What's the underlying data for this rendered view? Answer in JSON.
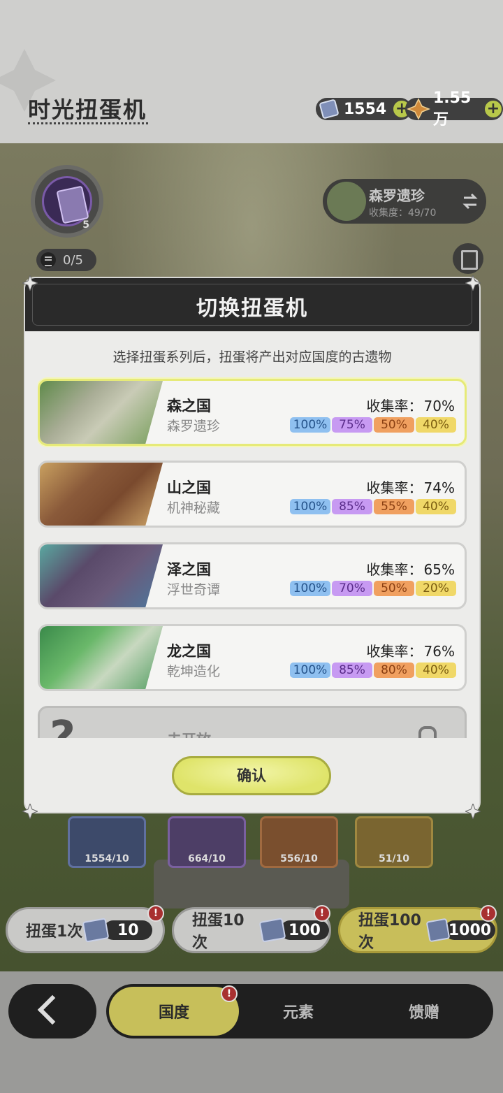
{
  "header": {
    "title": "时光扭蛋机",
    "currencies": [
      {
        "icon": "ticket-icon",
        "amount": "1554"
      },
      {
        "icon": "star-gem-icon",
        "amount": "1.55万"
      }
    ]
  },
  "background": {
    "medal_count": "5",
    "progress": "0/5",
    "series_chip": {
      "name": "森罗遗珍",
      "collection": "收集度：49/70"
    },
    "prize_slots": [
      "1554/10",
      "664/10",
      "556/10",
      "51/10"
    ],
    "draw_buttons": [
      {
        "label": "扭蛋1次",
        "cost": "10"
      },
      {
        "label": "扭蛋10次",
        "cost": "100"
      },
      {
        "label": "扭蛋100次",
        "cost": "1000"
      }
    ],
    "alert_mark": "!"
  },
  "modal": {
    "title": "切换扭蛋机",
    "subtitle": "选择扭蛋系列后，扭蛋将产出对应国度的古遗物",
    "rate_label": "收集率：",
    "items": [
      {
        "country": "森之国",
        "series": "森罗遗珍",
        "rate": "70%",
        "tiers": [
          "100%",
          "75%",
          "50%",
          "40%"
        ],
        "selected": true
      },
      {
        "country": "山之国",
        "series": "机神秘藏",
        "rate": "74%",
        "tiers": [
          "100%",
          "85%",
          "55%",
          "40%"
        ]
      },
      {
        "country": "泽之国",
        "series": "浮世奇谭",
        "rate": "65%",
        "tiers": [
          "100%",
          "70%",
          "50%",
          "20%"
        ]
      },
      {
        "country": "龙之国",
        "series": "乾坤造化",
        "rate": "76%",
        "tiers": [
          "100%",
          "85%",
          "80%",
          "40%"
        ]
      }
    ],
    "locked_item": {
      "label": "未开放"
    },
    "confirm_label": "确认"
  },
  "nav": {
    "tabs": [
      "国度",
      "元素",
      "馈赠"
    ],
    "active_tab": "国度"
  },
  "colors": {
    "tier_blue": "#8fc0f0",
    "tier_purple": "#c79af2",
    "tier_orange": "#f0a060",
    "tier_yellow": "#f0d868",
    "accent": "#dfe46a",
    "alert": "#a83030"
  }
}
